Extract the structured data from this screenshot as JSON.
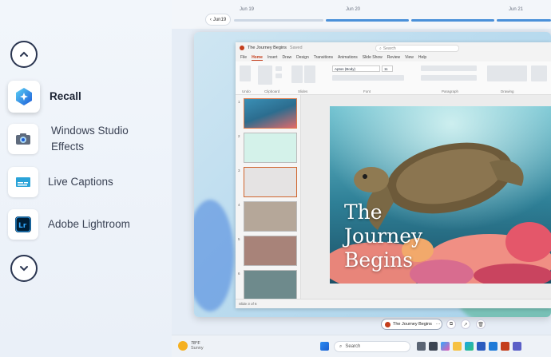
{
  "features": {
    "up_button": "scroll-up",
    "down_button": "scroll-down",
    "items": [
      {
        "label": "Recall",
        "icon": "recall-icon",
        "active": true
      },
      {
        "label": "Windows Studio Effects",
        "icon": "camera-icon",
        "active": false
      },
      {
        "label": "Live Captions",
        "icon": "captions-icon",
        "active": false
      },
      {
        "label": "Adobe Lightroom",
        "icon": "lightroom-icon",
        "active": false
      }
    ]
  },
  "timeline": {
    "back_label": "Jun19",
    "dates": [
      "Jun 19",
      "Jun 20",
      "Jun 21"
    ]
  },
  "powerpoint": {
    "title": "The Journey Begins",
    "saved": "Saved",
    "search_placeholder": "Search",
    "menu": [
      "File",
      "Home",
      "Insert",
      "Draw",
      "Design",
      "Transitions",
      "Animations",
      "Slide Show",
      "Review",
      "View",
      "Help"
    ],
    "ribbon_groups": [
      "Undo",
      "Clipboard",
      "Slides",
      "Font",
      "Paragraph",
      "Drawing"
    ],
    "font_name": "Aptos (Body)",
    "font_size": "11",
    "slide_title": "The\nJourney\nBegins",
    "status": "Slide 3 of 6",
    "slide_numbers": [
      "1",
      "2",
      "3",
      "4",
      "5",
      "6"
    ]
  },
  "file_pill": {
    "label": "The Journey Begins"
  },
  "taskbar": {
    "temp": "78°F",
    "condition": "Sunny",
    "search_placeholder": "Search"
  },
  "colors": {
    "accent": "#2b6cd4",
    "ppt": "#c43e1c",
    "timeline": "#4a90d9"
  }
}
